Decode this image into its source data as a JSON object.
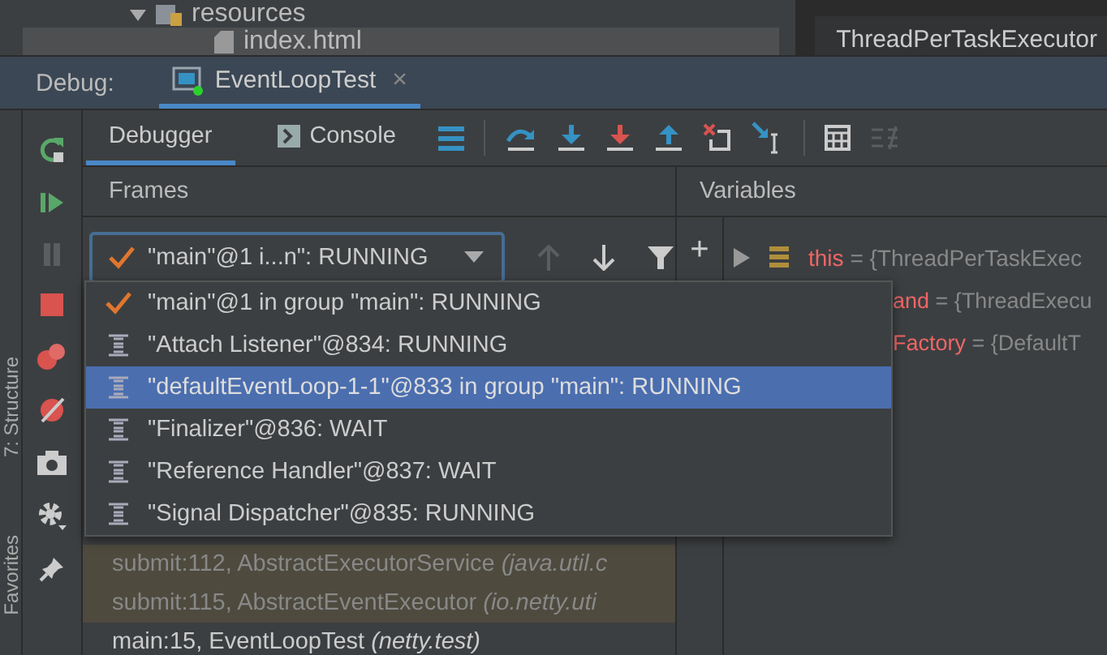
{
  "project_tree": [
    {
      "label": "resources",
      "kind": "folder",
      "selected": false
    },
    {
      "label": "index.html",
      "kind": "file",
      "selected": true
    }
  ],
  "editor_tab": {
    "label": "ThreadPerTaskExecutor"
  },
  "debug": {
    "label": "Debug:",
    "tab": {
      "label": "EventLoopTest",
      "close": "×",
      "running": true
    }
  },
  "side_labels": [
    {
      "label": "7: Structure"
    },
    {
      "label": "Favorites"
    }
  ],
  "tabs": [
    {
      "label": "Debugger",
      "selected": true
    },
    {
      "label": "Console",
      "selected": false
    }
  ],
  "frames": {
    "title": "Frames",
    "thread_combo": "\"main\"@1 i...n\": RUNNING",
    "threads": [
      {
        "label": "\"main\"@1 in group \"main\": RUNNING",
        "kind": "current",
        "selected": false
      },
      {
        "label": "\"Attach Listener\"@834: RUNNING",
        "kind": "thread",
        "selected": false
      },
      {
        "label": "\"defaultEventLoop-1-1\"@833 in group \"main\": RUNNING",
        "kind": "thread",
        "selected": true
      },
      {
        "label": "\"Finalizer\"@836: WAIT",
        "kind": "thread",
        "selected": false
      },
      {
        "label": "\"Reference Handler\"@837: WAIT",
        "kind": "thread",
        "selected": false
      },
      {
        "label": "\"Signal Dispatcher\"@835: RUNNING",
        "kind": "thread",
        "selected": false
      }
    ],
    "stack": [
      {
        "method": "submit:112, AbstractExecutorService",
        "package": "(java.util.c",
        "kind": "library"
      },
      {
        "method": "submit:115, AbstractEventExecutor",
        "package": "(io.netty.uti",
        "kind": "library"
      },
      {
        "method": "main:15, EventLoopTest",
        "package": "(netty.test)",
        "kind": "user"
      }
    ]
  },
  "variables": {
    "title": "Variables",
    "add": "+",
    "rows": [
      {
        "name": "this",
        "value": "= {ThreadPerTaskExec",
        "kind": "full"
      },
      {
        "name": "and",
        "value": "= {ThreadExecu",
        "kind": "covered"
      },
      {
        "name": "Factory",
        "value": "= {DefaultT",
        "kind": "covered"
      }
    ]
  }
}
